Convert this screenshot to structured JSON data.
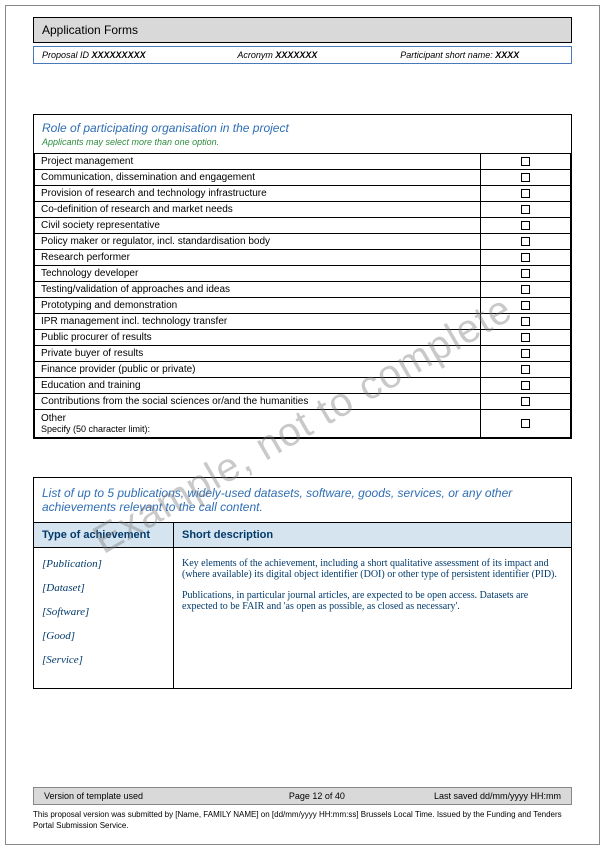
{
  "header": {
    "title": "Application Forms",
    "proposal_id_label": "Proposal ID",
    "proposal_id_value": "XXXXXXXXX",
    "acronym_label": "Acronym",
    "acronym_value": "XXXXXXX",
    "participant_label": "Participant short name:",
    "participant_value": "XXXX"
  },
  "roles": {
    "title": "Role of participating organisation in the project",
    "subtitle": "Applicants may select more than one option.",
    "items": [
      "Project management",
      "Communication, dissemination and engagement",
      "Provision of research and technology infrastructure",
      "Co-definition of research and market needs",
      "Civil society representative",
      "Policy maker or regulator, incl. standardisation body",
      "Research performer",
      "Technology developer",
      "Testing/validation of approaches and ideas",
      "Prototyping and demonstration",
      "IPR management incl. technology transfer",
      "Public procurer of results",
      "Private buyer of results",
      "Finance provider (public or private)",
      "Education and training",
      "Contributions from the social sciences or/and the humanities"
    ],
    "other_label": "Other",
    "other_sub": "Specify (50 character limit):"
  },
  "publications": {
    "title": "List of up to 5 publications, widely-used datasets, software, goods, services, or any other achievements relevant to the call content.",
    "col1": "Type of achievement",
    "col2": "Short description",
    "types": [
      "[Publication]",
      "[Dataset]",
      "[Software]",
      "[Good]",
      "[Service]"
    ],
    "desc_p1": "Key elements of the achievement, including a short qualitative assessment of its impact and (where available) its digital object identifier (DOI) or other type of persistent identifier (PID).",
    "desc_p2": "Publications, in particular journal articles, are expected to be open access. Datasets are expected to be FAIR and 'as open as possible, as closed as necessary'."
  },
  "footer": {
    "version": "Version of template used",
    "page": "Page 12 of 40",
    "saved": "Last saved  dd/mm/yyyy HH:mm",
    "note": "This proposal version was submitted by [Name, FAMILY NAME] on [dd/mm/yyyy HH:mm:ss] Brussels Local Time. Issued by the Funding and Tenders Portal Submission Service."
  },
  "watermark": "Example, not to complete"
}
